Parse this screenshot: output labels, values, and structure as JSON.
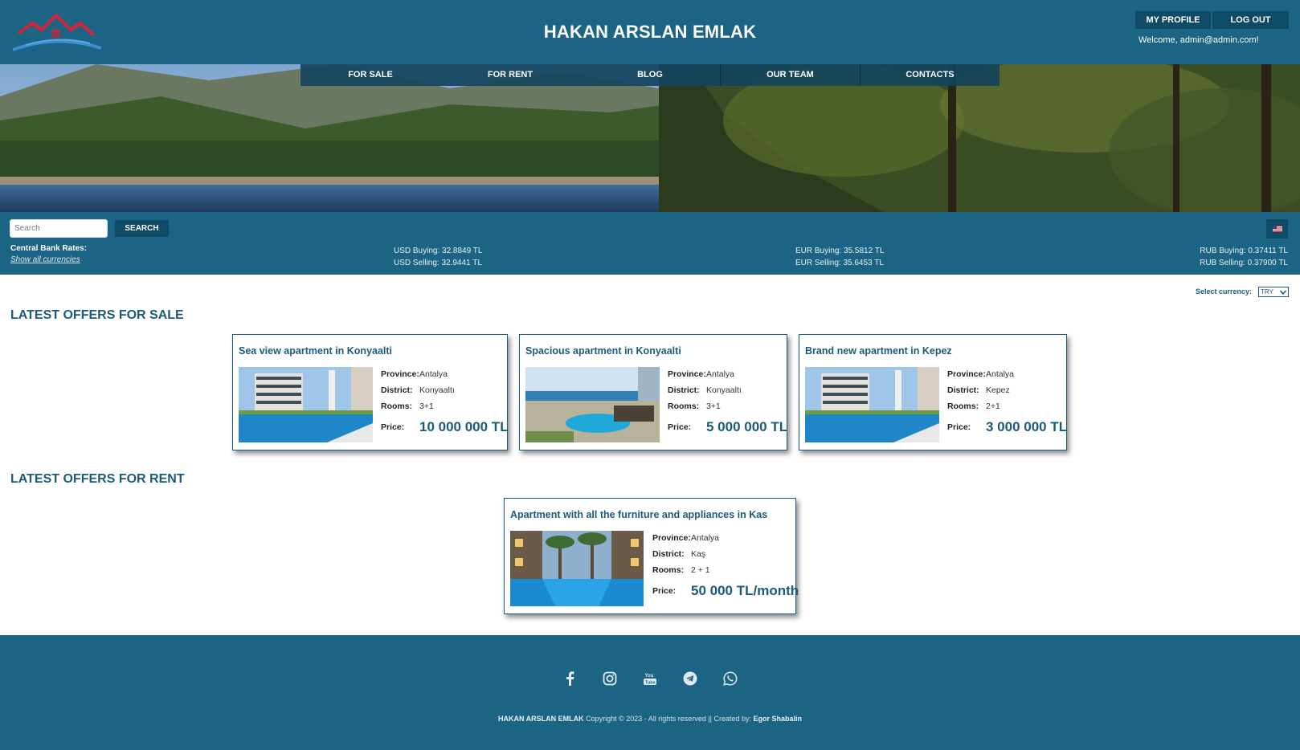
{
  "header": {
    "title": "HAKAN ARSLAN EMLAK",
    "my_profile": "MY PROFILE",
    "log_out": "LOG OUT",
    "welcome": "Welcome, admin@admin.com!"
  },
  "nav": {
    "items": [
      {
        "label": "FOR SALE"
      },
      {
        "label": "FOR RENT"
      },
      {
        "label": "BLOG"
      },
      {
        "label": "OUR TEAM"
      },
      {
        "label": "CONTACTS"
      }
    ]
  },
  "search": {
    "placeholder": "Search",
    "button": "SEARCH"
  },
  "rates": {
    "label": "Central Bank Rates:",
    "show_all": "Show all currencies",
    "usd_buying": "USD Buying: 32.8849 TL",
    "usd_selling": "USD Selling: 32.9441 TL",
    "eur_buying": "EUR Buying: 35.5812 TL",
    "eur_selling": "EUR Selling: 35.6453 TL",
    "rub_buying": "RUB Buying: 0.37411 TL",
    "rub_selling": "RUB Selling: 0.37900 TL"
  },
  "currency": {
    "label": "Select currency:",
    "selected": "TRY"
  },
  "sale": {
    "heading": "LATEST OFFERS FOR SALE",
    "cards": [
      {
        "title": "Sea view apartment in Konyaalti",
        "province": "Antalya",
        "district": "Konyaaltı",
        "rooms": "3+1",
        "price": "10 000 000 TL"
      },
      {
        "title": "Spacious apartment in Konyaalti",
        "province": "Antalya",
        "district": "Konyaaltı",
        "rooms": "3+1",
        "price": "5 000 000 TL"
      },
      {
        "title": "Brand new apartment in Kepez",
        "province": "Antalya",
        "district": "Kepez",
        "rooms": "2+1",
        "price": "3 000 000 TL"
      }
    ]
  },
  "rent": {
    "heading": "LATEST OFFERS FOR RENT",
    "cards": [
      {
        "title": "Apartment with all the furniture and appliances in Kas",
        "province": "Antalya",
        "district": "Kaş",
        "rooms": "2 + 1",
        "price": "50 000 TL/month"
      }
    ]
  },
  "labels": {
    "province": "Province:",
    "district": "District:",
    "rooms": "Rooms:",
    "price": "Price:"
  },
  "footer": {
    "brand": "HAKAN ARSLAN EMLAK",
    "copyright": " Copyright © 2023 - All rights reserved || Created by: ",
    "author": "Egor Shabalin",
    "icons": [
      "facebook-icon",
      "instagram-icon",
      "youtube-icon",
      "telegram-icon",
      "whatsapp-icon"
    ]
  },
  "colors": {
    "primary": "#1c6484",
    "dark": "#0f4a66",
    "text": "#1c5a7a"
  }
}
